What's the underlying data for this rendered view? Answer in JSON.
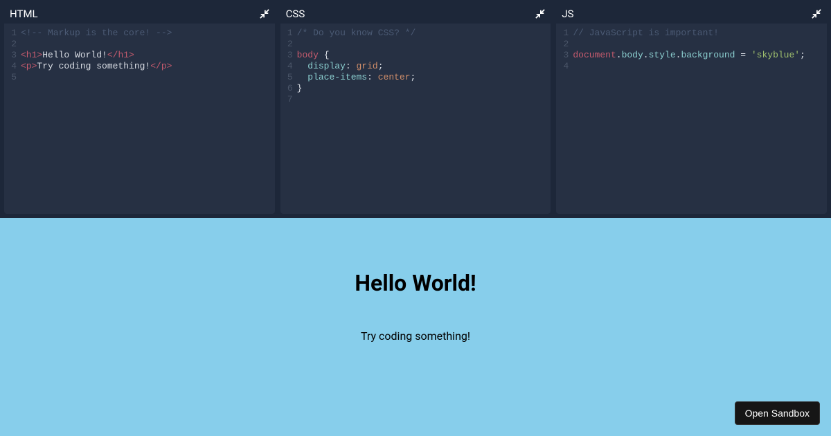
{
  "panes": {
    "html": {
      "title": "HTML",
      "line_numbers": [
        "1",
        "2",
        "3",
        "4",
        "5"
      ],
      "tokens": [
        [
          {
            "t": "<!-- Markup is the core! -->",
            "c": "tok-comment"
          }
        ],
        [],
        [
          {
            "t": "<h1>",
            "c": "tok-tag"
          },
          {
            "t": "Hello World!",
            "c": ""
          },
          {
            "t": "</h1>",
            "c": "tok-tag"
          }
        ],
        [
          {
            "t": "<p>",
            "c": "tok-tag"
          },
          {
            "t": "Try coding something!",
            "c": ""
          },
          {
            "t": "</p>",
            "c": "tok-tag"
          }
        ],
        []
      ]
    },
    "css": {
      "title": "CSS",
      "line_numbers": [
        "1",
        "2",
        "3",
        "4",
        "5",
        "6",
        "7"
      ],
      "tokens": [
        [
          {
            "t": "/* Do you know CSS? */",
            "c": "tok-comment"
          }
        ],
        [],
        [
          {
            "t": "body",
            "c": "tok-sel"
          },
          {
            "t": " {",
            "c": "tok-punc"
          }
        ],
        [
          {
            "t": "  ",
            "c": ""
          },
          {
            "t": "display",
            "c": "tok-prop"
          },
          {
            "t": ": ",
            "c": "tok-punc"
          },
          {
            "t": "grid",
            "c": "tok-val"
          },
          {
            "t": ";",
            "c": "tok-punc"
          }
        ],
        [
          {
            "t": "  ",
            "c": ""
          },
          {
            "t": "place-items",
            "c": "tok-prop"
          },
          {
            "t": ": ",
            "c": "tok-punc"
          },
          {
            "t": "center",
            "c": "tok-val"
          },
          {
            "t": ";",
            "c": "tok-punc"
          }
        ],
        [
          {
            "t": "}",
            "c": "tok-punc"
          }
        ],
        []
      ]
    },
    "js": {
      "title": "JS",
      "line_numbers": [
        "1",
        "2",
        "3",
        "4"
      ],
      "tokens": [
        [
          {
            "t": "// JavaScript is important!",
            "c": "tok-comment"
          }
        ],
        [],
        [
          {
            "t": "document",
            "c": "tok-sel"
          },
          {
            "t": ".",
            "c": "tok-punc"
          },
          {
            "t": "body",
            "c": "tok-obj"
          },
          {
            "t": ".",
            "c": "tok-punc"
          },
          {
            "t": "style",
            "c": "tok-obj"
          },
          {
            "t": ".",
            "c": "tok-punc"
          },
          {
            "t": "background",
            "c": "tok-obj"
          },
          {
            "t": " = ",
            "c": "tok-punc"
          },
          {
            "t": "'skyblue'",
            "c": "tok-str"
          },
          {
            "t": ";",
            "c": "tok-punc"
          }
        ],
        []
      ]
    }
  },
  "preview": {
    "heading": "Hello World!",
    "paragraph": "Try coding something!"
  },
  "open_sandbox_label": "Open Sandbox"
}
